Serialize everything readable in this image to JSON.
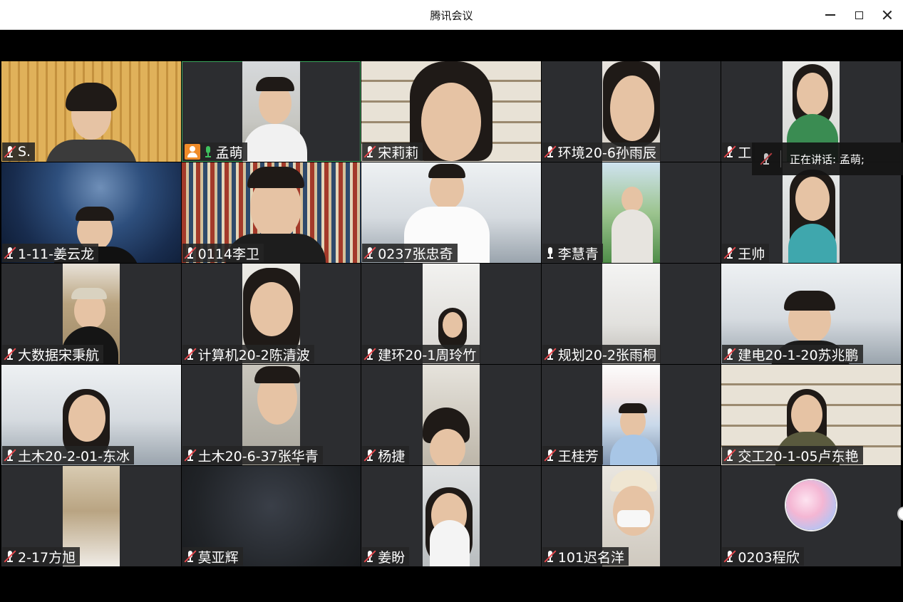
{
  "window": {
    "title": "腾讯会议",
    "controls": {
      "minimize_icon": "minimize-icon",
      "maximize_icon": "maximize-icon",
      "close_icon": "close-icon"
    }
  },
  "colors": {
    "muted_mic": "#e5484d",
    "live_mic": "#3fc25e",
    "host_badge": "#f08c2a",
    "speaking_border": "#3ba55c"
  },
  "speaking_indicator": {
    "text": "正在讲话: 孟萌;"
  },
  "participants": [
    {
      "name": "S.",
      "mic": "muted"
    },
    {
      "name": "孟萌",
      "mic": "live",
      "host": true,
      "speaking": true
    },
    {
      "name": "宋莉莉",
      "mic": "muted"
    },
    {
      "name": "环境20-6孙雨辰",
      "mic": "muted"
    },
    {
      "name": "工",
      "mic": "muted"
    },
    {
      "name": "1-11-姜云龙",
      "mic": "muted"
    },
    {
      "name": "0114李卫",
      "mic": "muted"
    },
    {
      "name": "0237张忠奇",
      "mic": "muted"
    },
    {
      "name": "李慧青",
      "mic": "on"
    },
    {
      "name": "王帅",
      "mic": "muted"
    },
    {
      "name": "大数据宋秉航",
      "mic": "muted"
    },
    {
      "name": "计算机20-2陈清波",
      "mic": "muted"
    },
    {
      "name": "建环20-1周玲竹",
      "mic": "muted"
    },
    {
      "name": "规划20-2张雨桐",
      "mic": "muted"
    },
    {
      "name": "建电20-1-20苏兆鹏",
      "mic": "muted"
    },
    {
      "name": "土木20-2-01-东冰",
      "mic": "muted"
    },
    {
      "name": "土木20-6-37张华青",
      "mic": "muted"
    },
    {
      "name": "杨捷",
      "mic": "muted"
    },
    {
      "name": "王桂芳",
      "mic": "muted"
    },
    {
      "name": "交工20-1-05卢东艳",
      "mic": "muted"
    },
    {
      "name": "2-17方旭",
      "mic": "muted"
    },
    {
      "name": "莫亚辉",
      "mic": "muted"
    },
    {
      "name": "姜盼",
      "mic": "muted"
    },
    {
      "name": "101迟名洋",
      "mic": "muted"
    },
    {
      "name": "0203程欣",
      "mic": "muted"
    }
  ]
}
